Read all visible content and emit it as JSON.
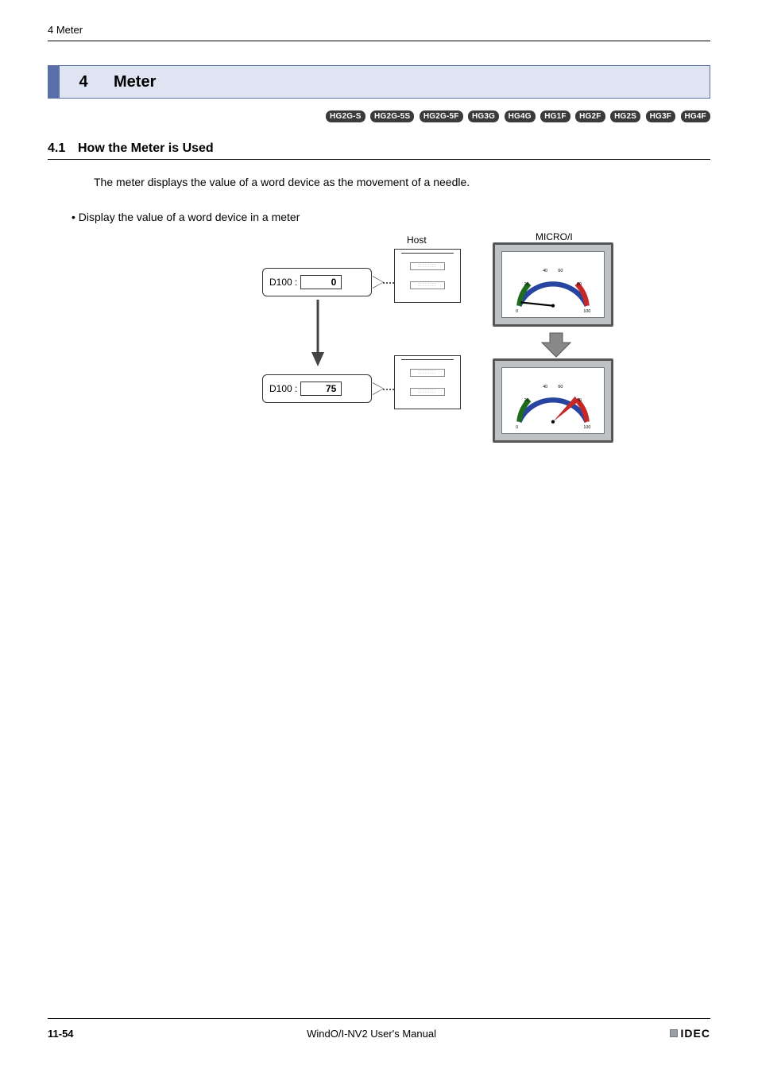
{
  "header": {
    "running": "4 Meter"
  },
  "section": {
    "number": "4",
    "title": "Meter"
  },
  "models": [
    "HG2G-S",
    "HG2G-5S",
    "HG2G-5F",
    "HG3G",
    "HG4G",
    "HG1F",
    "HG2F",
    "HG2S",
    "HG3F",
    "HG4F"
  ],
  "subsection": {
    "number": "4.1",
    "title": "How the Meter is Used"
  },
  "body": {
    "intro": "The meter displays the value of a word device as the movement of a needle.",
    "bullet": "• Display the value of a word device in a meter"
  },
  "diagram": {
    "hostLabel": "Host",
    "microLabel": "MICRO/I",
    "rows": [
      {
        "device": "D100 :",
        "value": "0",
        "needleDeg": -80
      },
      {
        "device": "D100 :",
        "value": "75",
        "needleDeg": 50
      }
    ],
    "gauge": {
      "ticks": [
        "0",
        "20",
        "40",
        "60",
        "80",
        "100"
      ],
      "zones": [
        {
          "from": 0,
          "to": 20,
          "color": "#1e6b1e"
        },
        {
          "from": 20,
          "to": 80,
          "color": "#2644a0"
        },
        {
          "from": 80,
          "to": 100,
          "color": "#c62828"
        }
      ]
    }
  },
  "footer": {
    "page": "11-54",
    "manual": "WindO/I-NV2 User's Manual",
    "brand": "IDEC"
  }
}
